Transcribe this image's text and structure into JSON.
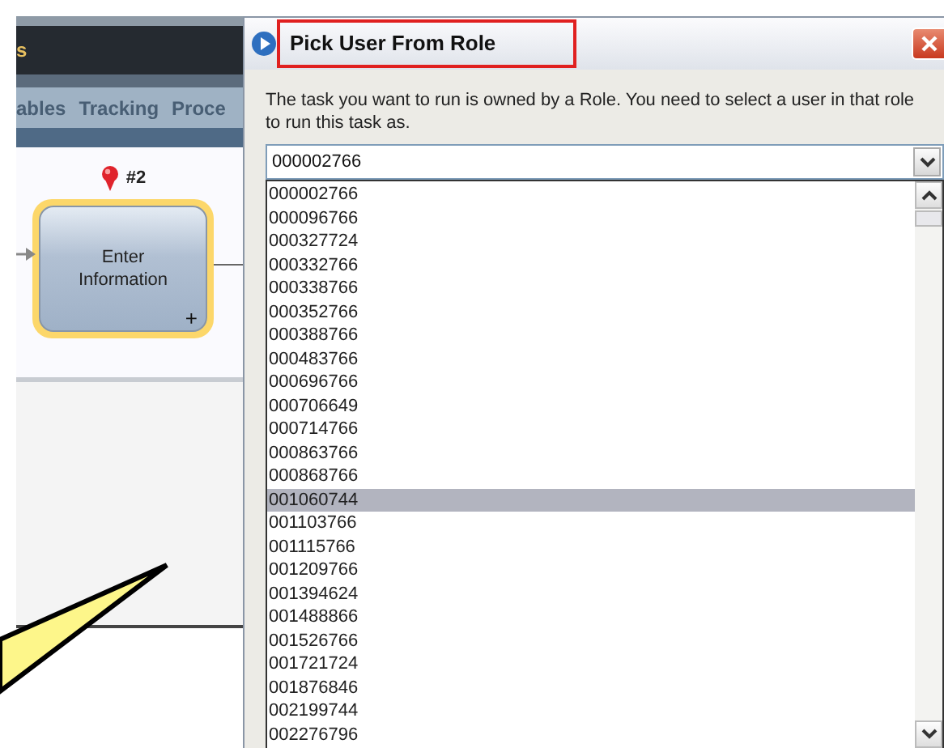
{
  "background_app": {
    "header_text": "s",
    "tabs": [
      {
        "label": "ables"
      },
      {
        "label": "Tracking"
      },
      {
        "label": "Proce"
      }
    ],
    "node": {
      "label": "Enter Information",
      "marker": "#2",
      "expand": "+"
    }
  },
  "dialog": {
    "title": "Pick User From Role",
    "title_highlighted": true,
    "message": "The task you want to run is owned by a Role. You need to select a user in that role to run this task as.",
    "combo": {
      "value": "000002766"
    },
    "options": [
      {
        "label": "000002766",
        "selected": false
      },
      {
        "label": "000096766",
        "selected": false
      },
      {
        "label": "000327724",
        "selected": false
      },
      {
        "label": "000332766",
        "selected": false
      },
      {
        "label": "000338766",
        "selected": false
      },
      {
        "label": "000352766",
        "selected": false
      },
      {
        "label": "000388766",
        "selected": false
      },
      {
        "label": "000483766",
        "selected": false
      },
      {
        "label": "000696766",
        "selected": false
      },
      {
        "label": "000706649",
        "selected": false
      },
      {
        "label": "000714766",
        "selected": false
      },
      {
        "label": "000863766",
        "selected": false
      },
      {
        "label": "000868766",
        "selected": false
      },
      {
        "label": "001060744",
        "selected": true
      },
      {
        "label": "001103766",
        "selected": false
      },
      {
        "label": "001115766",
        "selected": false
      },
      {
        "label": "001209766",
        "selected": false
      },
      {
        "label": "001394624",
        "selected": false
      },
      {
        "label": "001488866",
        "selected": false
      },
      {
        "label": "001526766",
        "selected": false
      },
      {
        "label": "001721724",
        "selected": false
      },
      {
        "label": "001876846",
        "selected": false
      },
      {
        "label": "002199744",
        "selected": false
      },
      {
        "label": "002276796",
        "selected": false
      }
    ]
  }
}
